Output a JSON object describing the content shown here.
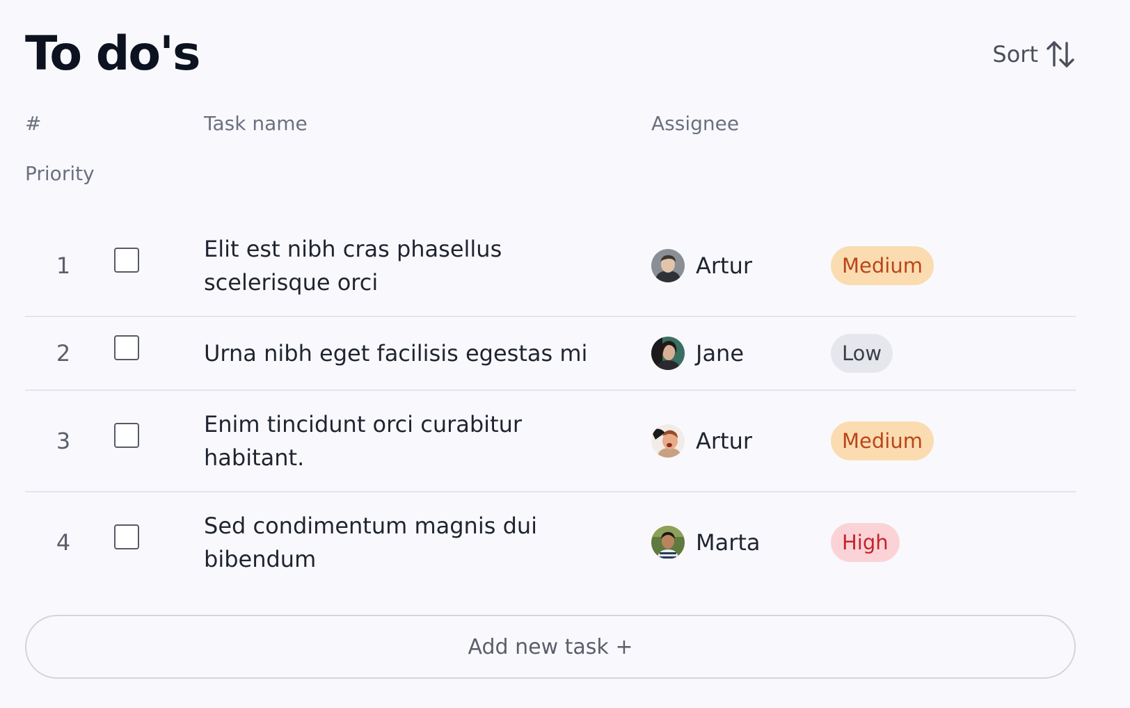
{
  "header": {
    "title": "To do's",
    "sort_label": "Sort",
    "sort_icon": "sort-arrows-icon"
  },
  "columns": {
    "number": "#",
    "task_name": "Task name",
    "assignee": "Assignee",
    "priority": "Priority"
  },
  "tasks": [
    {
      "number": "1",
      "name": "Elit est nibh cras phasellus scelerisque orci",
      "assignee": "Artur",
      "priority": "Medium",
      "checked": false
    },
    {
      "number": "2",
      "name": "Urna nibh eget facilisis egestas mi",
      "assignee": "Jane",
      "priority": "Low",
      "checked": false
    },
    {
      "number": "3",
      "name": "Enim tincidunt orci curabitur habitant.",
      "assignee": "Artur",
      "priority": "Medium",
      "checked": false
    },
    {
      "number": "4",
      "name": "Sed condimentum magnis dui bibendum",
      "assignee": "Marta",
      "priority": "High",
      "checked": false
    }
  ],
  "priority_colors": {
    "Medium": {
      "background": "#fbdcb0",
      "text": "#b8461a"
    },
    "Low": {
      "background": "#e6e7ec",
      "text": "#3a3f4a"
    },
    "High": {
      "background": "#fbd3d6",
      "text": "#c4242e"
    }
  },
  "add_task_label": "Add new task +"
}
